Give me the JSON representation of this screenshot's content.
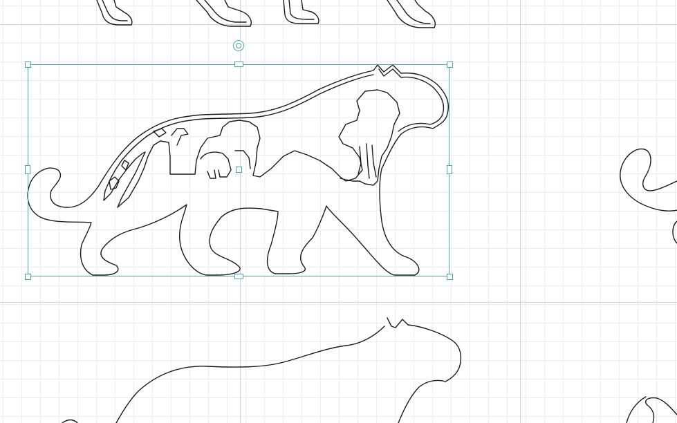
{
  "canvas": {
    "background": "#ffffff",
    "grid_minor_color": "#ebedf0",
    "grid_major_color": "#cfd3d8",
    "selection_color": "#4aa79e",
    "stroke_color": "#1a1a1a"
  },
  "selection": {
    "handles": [
      "top-left",
      "top-center",
      "top-right",
      "middle-left",
      "middle-right",
      "bottom-left",
      "bottom-center",
      "bottom-right"
    ],
    "rotate_handle_icon": "rotate-icon",
    "center_marker": "center-point"
  },
  "shapes": [
    {
      "name": "selected-cheetah-savanna-cutout",
      "selected": true
    },
    {
      "name": "paws-row-top",
      "selected": false
    },
    {
      "name": "cheetah-outline-bottom",
      "selected": false
    },
    {
      "name": "tail-curl-right",
      "selected": false
    }
  ]
}
